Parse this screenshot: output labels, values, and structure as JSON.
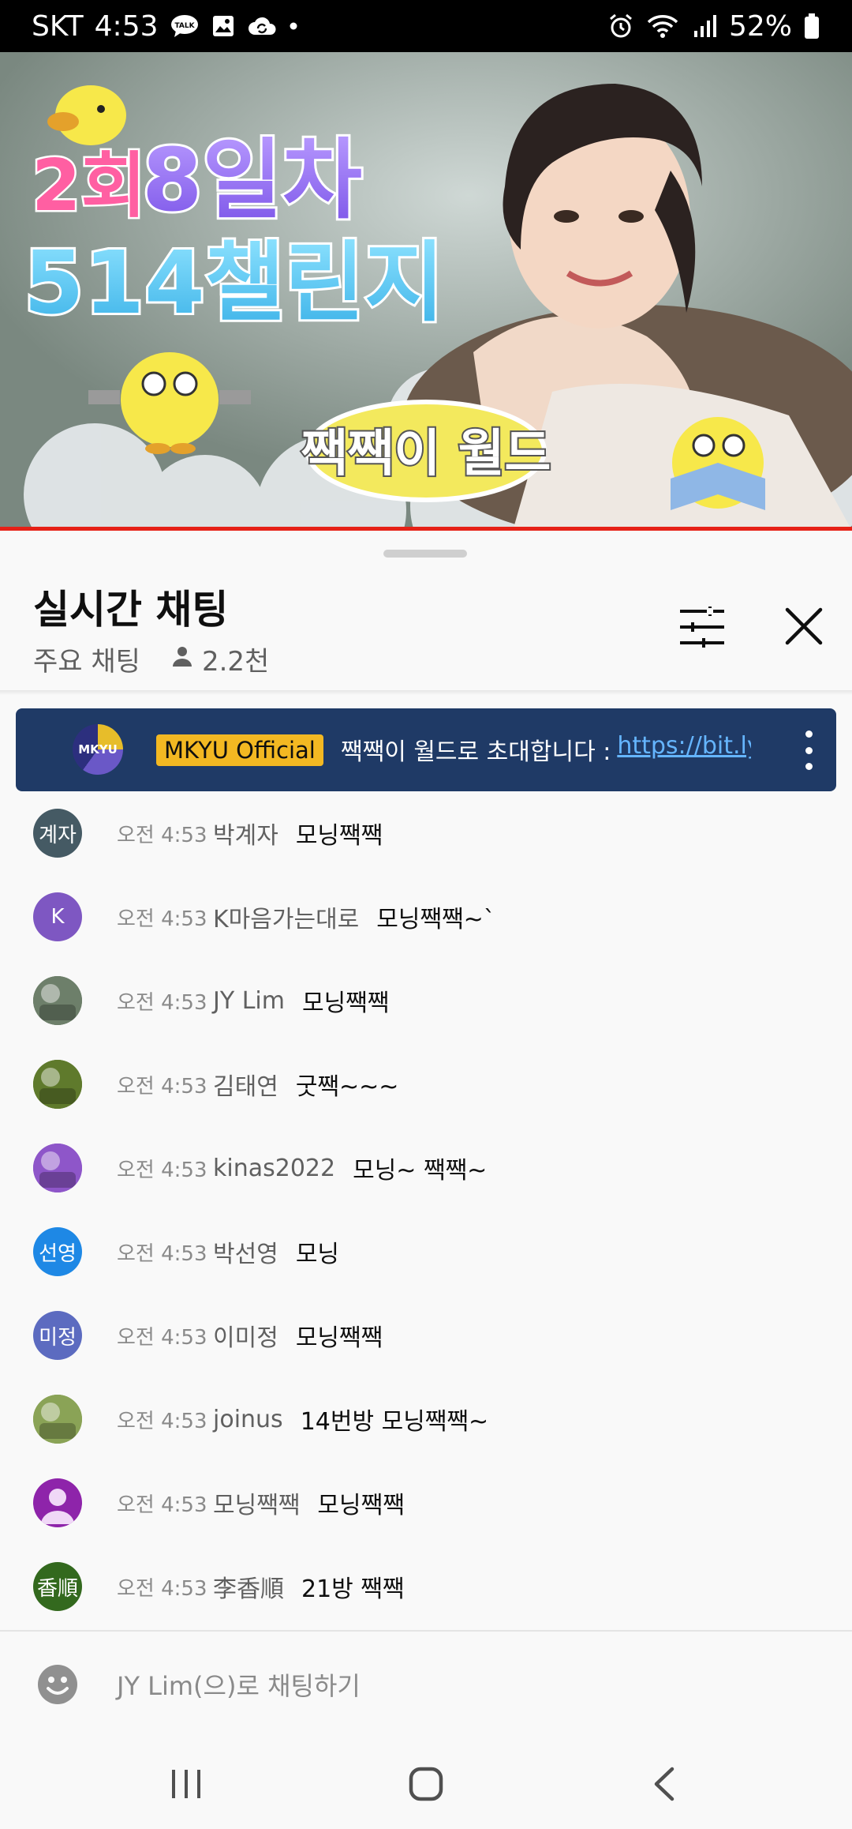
{
  "status_bar": {
    "carrier": "SKT",
    "time": "4:53",
    "battery": "52%",
    "icons": [
      "talk-icon",
      "gallery-icon",
      "cloud-sync-icon",
      "dot-icon",
      "alarm-icon",
      "wifi-icon",
      "signal-icon",
      "battery-icon"
    ]
  },
  "video": {
    "episode_badge": "2회",
    "day_title": "8일차",
    "challenge_title": "514챌린지",
    "brand_title": "짹짹이 월드",
    "progress_color": "#e62117"
  },
  "chat_header": {
    "title": "실시간 채팅",
    "mode_label": "주요 채팅",
    "viewer_count": "2.2천"
  },
  "pinned": {
    "avatar_text": "MKYU",
    "author_badge": "MKYU Official",
    "message": "짹짹이 월드로 초대합니다 :",
    "link": "https://bit.ly",
    "badge_color": "#f3b822",
    "background_color": "#1f3a66"
  },
  "messages": [
    {
      "avatar": {
        "type": "initials",
        "text": "계자",
        "color": "#455a64"
      },
      "time": "오전 4:53",
      "author": "박계자",
      "text": "모닝짹짹"
    },
    {
      "avatar": {
        "type": "initials",
        "text": "K",
        "color": "#7e57c2"
      },
      "time": "오전 4:53",
      "author": "K마음가는대로",
      "text": "모닝짹짹~`"
    },
    {
      "avatar": {
        "type": "photo",
        "text": "",
        "color": "#6d7f6a"
      },
      "time": "오전 4:53",
      "author": "JY Lim",
      "text": "모닝짹짹"
    },
    {
      "avatar": {
        "type": "photo",
        "text": "",
        "color": "#5f7a2c"
      },
      "time": "오전 4:53",
      "author": "김태연",
      "text": "굿짹~~~"
    },
    {
      "avatar": {
        "type": "photo",
        "text": "",
        "color": "#8e56c9"
      },
      "time": "오전 4:53",
      "author": "kinas2022",
      "text": "모닝~ 짹짹~"
    },
    {
      "avatar": {
        "type": "initials",
        "text": "선영",
        "color": "#1e88e5"
      },
      "time": "오전 4:53",
      "author": "박선영",
      "text": "모닝"
    },
    {
      "avatar": {
        "type": "initials",
        "text": "미정",
        "color": "#5c6bc0"
      },
      "time": "오전 4:53",
      "author": "이미정",
      "text": "모닝짹짹"
    },
    {
      "avatar": {
        "type": "photo",
        "text": "",
        "color": "#8aa356"
      },
      "time": "오전 4:53",
      "author": "joinus",
      "text": "14번방 모닝짹짹~"
    },
    {
      "avatar": {
        "type": "default",
        "text": "",
        "color": "#8e24aa"
      },
      "time": "오전 4:53",
      "author": "모닝짹짹",
      "text": "모닝짹짹"
    },
    {
      "avatar": {
        "type": "initials",
        "text": "香順",
        "color": "#33691e"
      },
      "time": "오전 4:53",
      "author": "李香順",
      "text": "21방 짹짹"
    }
  ],
  "input": {
    "placeholder": "JY Lim(으)로 채팅하기"
  },
  "nav_bar": {
    "icons": [
      "recents-icon",
      "home-icon",
      "back-icon"
    ]
  }
}
